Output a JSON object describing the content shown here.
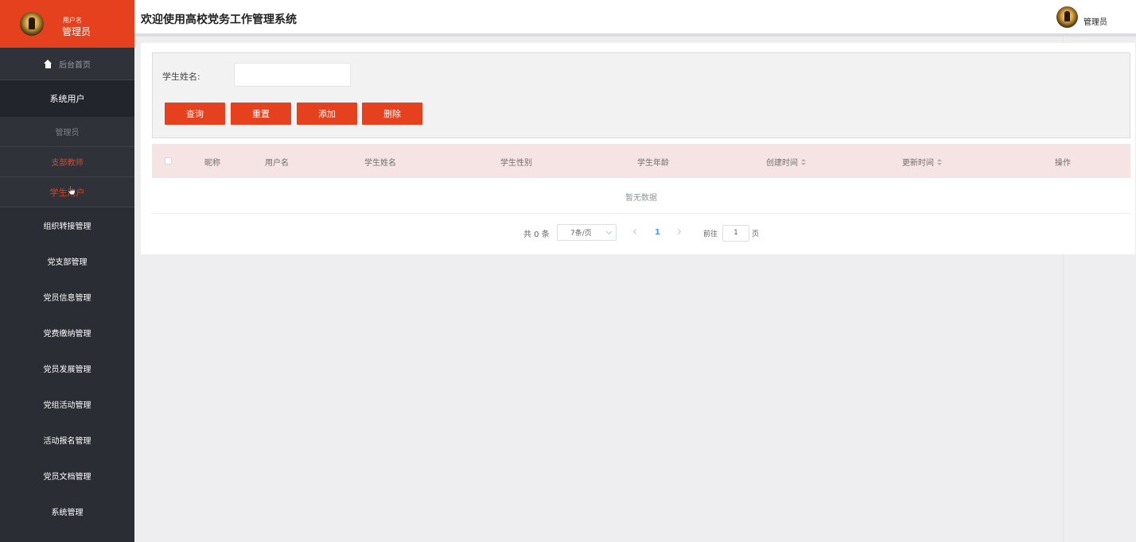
{
  "sidebar": {
    "user_small": "用户名",
    "user_name": "管理员",
    "home": "后台首页",
    "group": "系统用户",
    "sub_items": [
      "管理员",
      "支部教师",
      "学生用户"
    ],
    "menus": [
      "组织转接管理",
      "党支部管理",
      "党员信息管理",
      "党费缴纳管理",
      "党员发展管理",
      "党组活动管理",
      "活动报名管理",
      "党员文档管理",
      "系统管理"
    ]
  },
  "header": {
    "title": "欢迎使用高校党务工作管理系统",
    "user": "管理员"
  },
  "search": {
    "label": "学生姓名:",
    "value": ""
  },
  "buttons": {
    "query": "查询",
    "reset": "重置",
    "add": "添加",
    "delete": "删除"
  },
  "table": {
    "columns": [
      "昵称",
      "用户名",
      "学生姓名",
      "学生性别",
      "学生年龄",
      "创建时间",
      "更新时间",
      "操作"
    ],
    "empty_text": "暂无数据"
  },
  "pagination": {
    "total": "共 0 条",
    "page_size": "7条/页",
    "current_page": "1",
    "goto_label": "前往",
    "goto_value": "1",
    "goto_suffix": "页"
  },
  "colors": {
    "accent": "#e5411e",
    "sidebar_bg": "#2a2d33",
    "table_header_bg": "#f6e4e4",
    "page_bg": "#eeedf0"
  }
}
